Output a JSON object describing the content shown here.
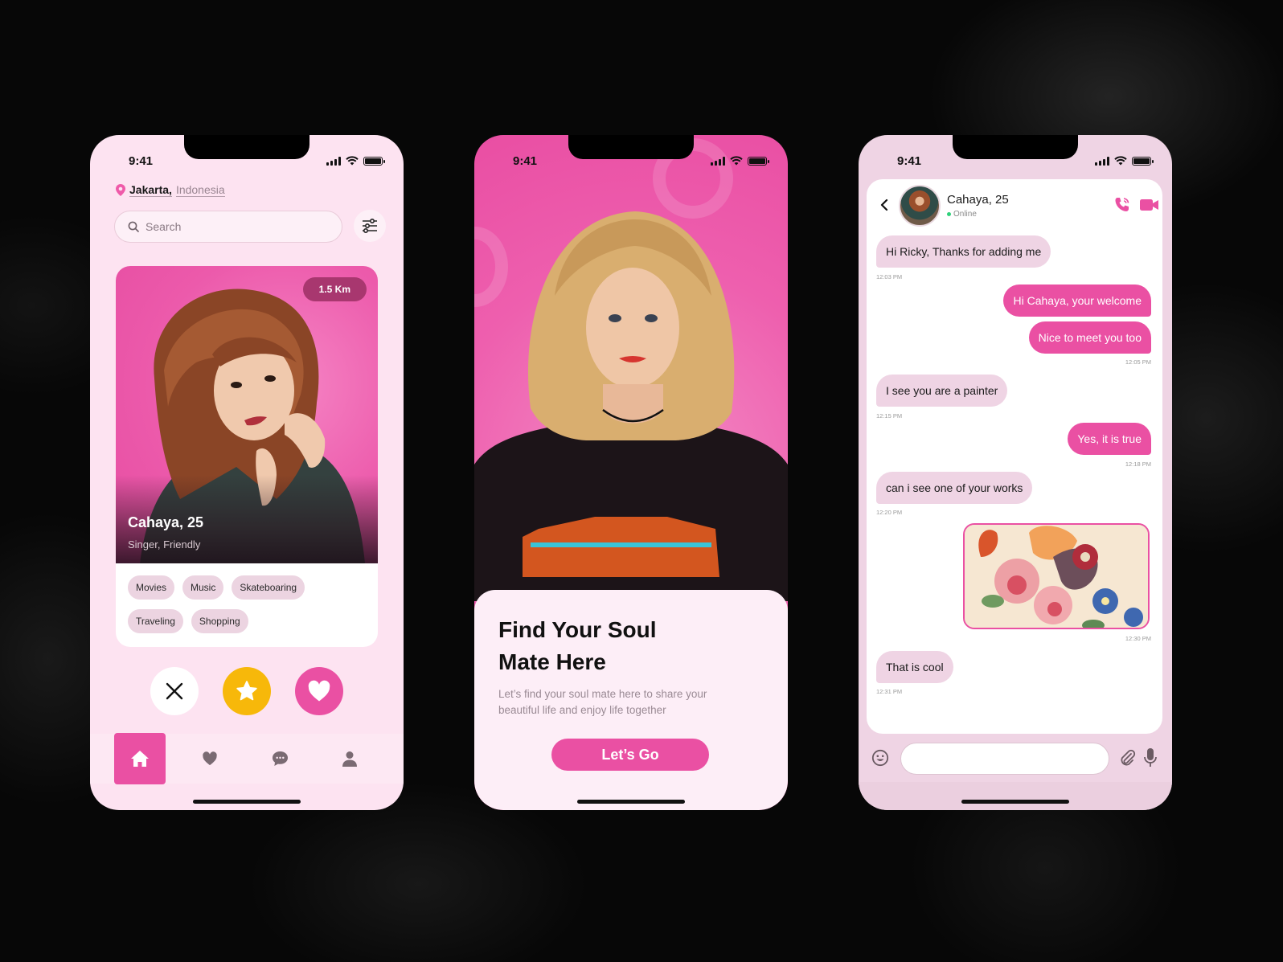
{
  "colors": {
    "accent_pink": "#ea50a3",
    "badge_plum": "#a8376f",
    "star_yellow": "#f7b80a",
    "phone1_bg": "#fde3f1",
    "phone3_bg": "#efd4e4",
    "tag_bg": "#ecd4e1",
    "online_green": "#2fd17a",
    "page_bg": "#070707"
  },
  "status_bar": {
    "time": "9:41",
    "icons": [
      "signal-icon",
      "wifi-icon",
      "battery-icon"
    ]
  },
  "discover": {
    "location": {
      "city": "Jakarta,",
      "country": "Indonesia",
      "icon": "map-pin-icon"
    },
    "search": {
      "placeholder": "Search",
      "value": "",
      "icon": "search-icon"
    },
    "filter_icon": "sliders-icon",
    "profile": {
      "distance": "1.5 Km",
      "name": "Cahaya, 25",
      "description": "Singer, Friendly",
      "interests": [
        "Movies",
        "Music",
        "Skateboaring",
        "Traveling",
        "Shopping"
      ]
    },
    "actions": [
      {
        "id": "dislike",
        "icon": "close-icon"
      },
      {
        "id": "super-like",
        "icon": "star-icon"
      },
      {
        "id": "like",
        "icon": "heart-icon"
      }
    ],
    "nav": [
      {
        "id": "home",
        "icon": "home-icon",
        "active": true
      },
      {
        "id": "favorites",
        "icon": "heart-icon",
        "active": false
      },
      {
        "id": "messages",
        "icon": "chat-bubble-icon",
        "active": false
      },
      {
        "id": "profile",
        "icon": "user-icon",
        "active": false
      }
    ]
  },
  "onboarding": {
    "title_line1": "Find Your Soul",
    "title_line2": "Mate Here",
    "subtitle": "Let’s find your soul mate here to share your beautiful life and enjoy life together",
    "cta": "Let’s Go"
  },
  "chat": {
    "contact": {
      "name": "Cahaya, 25",
      "status": "Online"
    },
    "header_icons": [
      "back-icon",
      "phone-call-icon",
      "video-camera-icon"
    ],
    "messages": [
      {
        "dir": "in",
        "text": "Hi Ricky, Thanks for adding me",
        "time": "12:03 PM"
      },
      {
        "dir": "out",
        "text": "Hi Cahaya, your welcome",
        "time": ""
      },
      {
        "dir": "out",
        "text": "Nice to meet you too",
        "time": "12:05 PM"
      },
      {
        "dir": "in",
        "text": "I see you are a painter",
        "time": "12:15 PM"
      },
      {
        "dir": "out",
        "text": "Yes, it is true",
        "time": "12:18 PM"
      },
      {
        "dir": "in",
        "text": "can i see one of your works",
        "time": "12:20 PM"
      },
      {
        "dir": "out",
        "type": "image",
        "alt": "flower painting",
        "time": "12:30 PM"
      },
      {
        "dir": "in",
        "text": "That is cool",
        "time": "12:31 PM"
      }
    ],
    "composer": {
      "placeholder": "",
      "value": "",
      "icons": [
        "emoji-icon",
        "paperclip-icon",
        "microphone-icon"
      ]
    }
  }
}
